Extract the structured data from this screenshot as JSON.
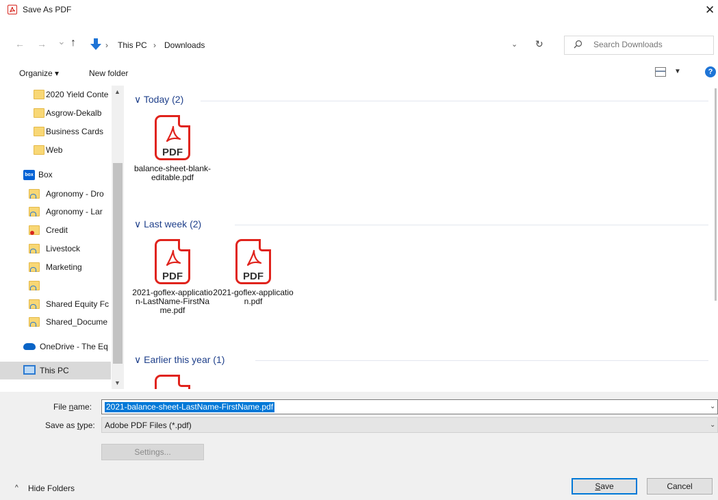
{
  "window": {
    "title": "Save As PDF",
    "close_symbol": "✕"
  },
  "nav": {
    "back_symbol": "←",
    "forward_symbol": "→",
    "recent_symbol": "⌄",
    "up_symbol": "↑",
    "path": [
      "This PC",
      "Downloads"
    ],
    "path_separator": "›",
    "refresh_symbol": "↻",
    "search_placeholder": "Search Downloads"
  },
  "toolbar": {
    "organize_label": "Organize ▾",
    "new_folder_label": "New folder",
    "help_label": "?"
  },
  "sidebar": {
    "items": [
      {
        "label": "2020 Yield Conte",
        "icon": "folder-icon"
      },
      {
        "label": "Asgrow-Dekalb",
        "icon": "folder-icon"
      },
      {
        "label": "Business Cards",
        "icon": "folder-icon"
      },
      {
        "label": "Web",
        "icon": "folder-icon"
      },
      {
        "label": "Box",
        "icon": "box-icon"
      },
      {
        "label": "Agronomy - Dro",
        "icon": "folder-sync-icon"
      },
      {
        "label": "Agronomy - Lar",
        "icon": "folder-sync-icon"
      },
      {
        "label": "Credit",
        "icon": "folder-error-icon"
      },
      {
        "label": "Livestock",
        "icon": "folder-sync-icon"
      },
      {
        "label": "Marketing",
        "icon": "folder-sync-icon"
      },
      {
        "label": "",
        "icon": "folder-sync-icon"
      },
      {
        "label": "Shared Equity Fc",
        "icon": "folder-sync-icon"
      },
      {
        "label": "Shared_Docume",
        "icon": "folder-sync-icon"
      },
      {
        "label": "OneDrive - The Eq",
        "icon": "onedrive-icon"
      },
      {
        "label": "This PC",
        "icon": "this-pc-icon"
      }
    ],
    "box_badge": "box"
  },
  "groups": [
    {
      "header": "Today (2)",
      "files": [
        {
          "name": "balance-sheet-blank-editable.pdf"
        }
      ]
    },
    {
      "header": "Last week (2)",
      "files": [
        {
          "name": "2021-goflex-application-LastName-FirstName.pdf"
        },
        {
          "name": "2021-goflex-application.pdf"
        }
      ]
    },
    {
      "header": "Earlier this year (1)",
      "files": []
    }
  ],
  "file_icon_label": "PDF",
  "group_chevron": "∨",
  "form": {
    "file_name_label_pre": "File ",
    "file_name_label_u": "n",
    "file_name_label_post": "ame:",
    "file_name_value": "2021-balance-sheet-LastName-FirstName.pdf",
    "save_type_label_pre": "Save as ",
    "save_type_label_u": "t",
    "save_type_label_post": "ype:",
    "save_type_value": "Adobe PDF Files (*.pdf)",
    "dropdown_symbol": "⌄",
    "settings_label": "Settings...",
    "save_label_u": "S",
    "save_label_post": "ave",
    "cancel_label": "Cancel",
    "hide_folders_label": "Hide Folders",
    "hide_folders_symbol": "^"
  }
}
